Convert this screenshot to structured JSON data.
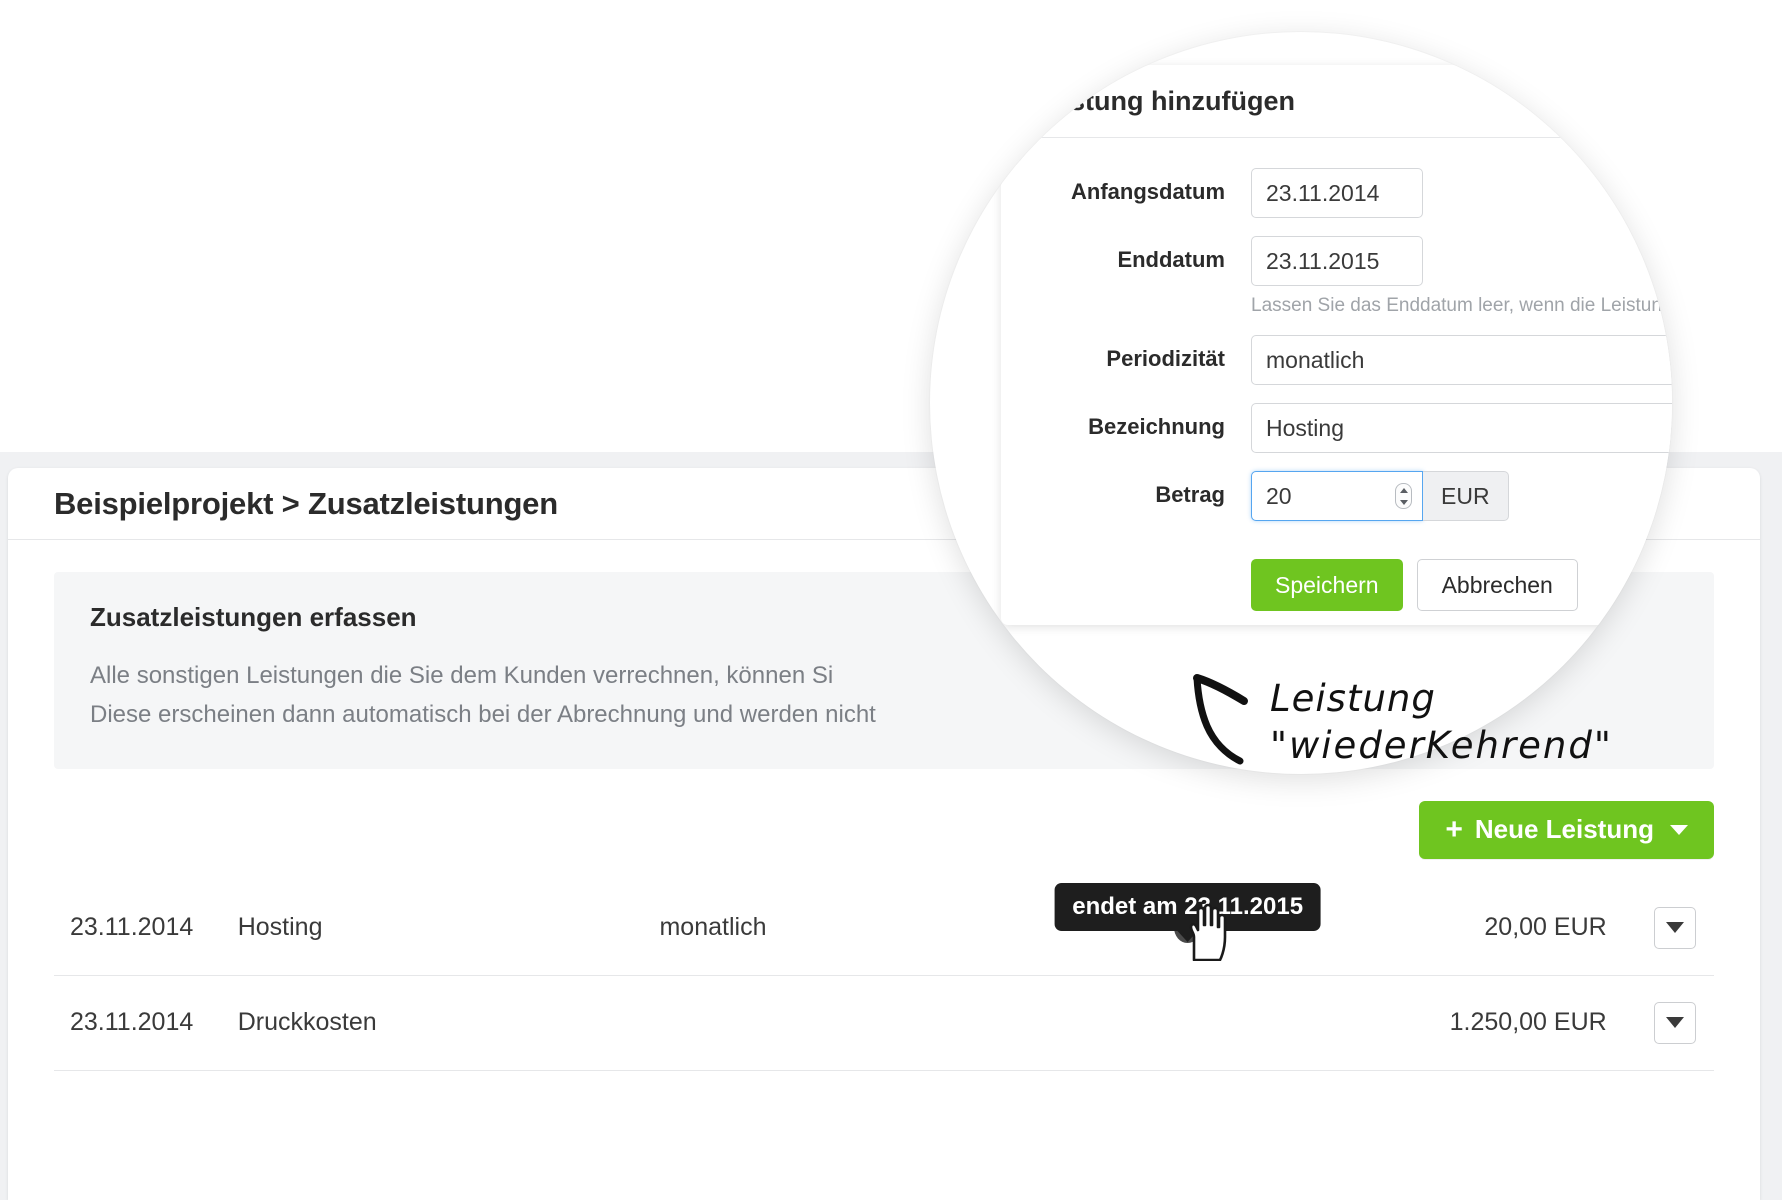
{
  "page": {
    "breadcrumb": "Beispielprojekt > Zusatzleistungen",
    "project": "Beispielprojekt",
    "section": "Zusatzleistungen"
  },
  "info_panel": {
    "heading": "Zusatzleistungen erfassen",
    "line1": "Alle sonstigen Leistungen die Sie dem Kunden verrechnen, können Si",
    "line2": "Diese erscheinen dann automatisch bei der Abrechnung und werden nicht"
  },
  "toolbar": {
    "new_service_label": "Neue Leistung",
    "plus_glyph": "+",
    "caret_icon": "chevron-down-icon"
  },
  "table": {
    "rows": [
      {
        "date": "23.11.2014",
        "name": "Hosting",
        "periodicity": "monatlich",
        "amount": "20,00 EUR",
        "recurring": true,
        "tooltip": "endet am 23.11.2015"
      },
      {
        "date": "23.11.2014",
        "name": "Druckkosten",
        "periodicity": "",
        "amount": "1.250,00 EUR",
        "recurring": false,
        "tooltip": ""
      }
    ],
    "row_menu_icon": "chevron-down-icon"
  },
  "modal": {
    "title": "Leistung hinzufügen",
    "fields": [
      {
        "label": "Anfangsdatum",
        "value": "23.11.2014"
      },
      {
        "label": "Enddatum",
        "value": "23.11.2015"
      },
      {
        "label": "Periodizität",
        "value": "monatlich"
      },
      {
        "label": "Bezeichnung",
        "value": "Hosting"
      },
      {
        "label": "Betrag",
        "value": "20"
      }
    ],
    "enddate_help": "Lassen Sie das Enddatum leer, wenn die Leistung",
    "currency_addon": "EUR",
    "save_label": "Speichern",
    "cancel_label": "Abbrechen"
  },
  "annotation": {
    "line1": "Leistung",
    "line2": "\"wiederKehrend\"",
    "arrow_icon": "hand-drawn-arrow-icon"
  },
  "colors": {
    "accent_green": "#6fc520",
    "page_bg": "#f0f1f3",
    "panel_bg": "#f5f6f7",
    "text_dark": "#2b2b2b",
    "text_muted": "#7b7f85",
    "focus_blue": "#56a6f0",
    "tooltip_bg": "#1e1e1e"
  }
}
